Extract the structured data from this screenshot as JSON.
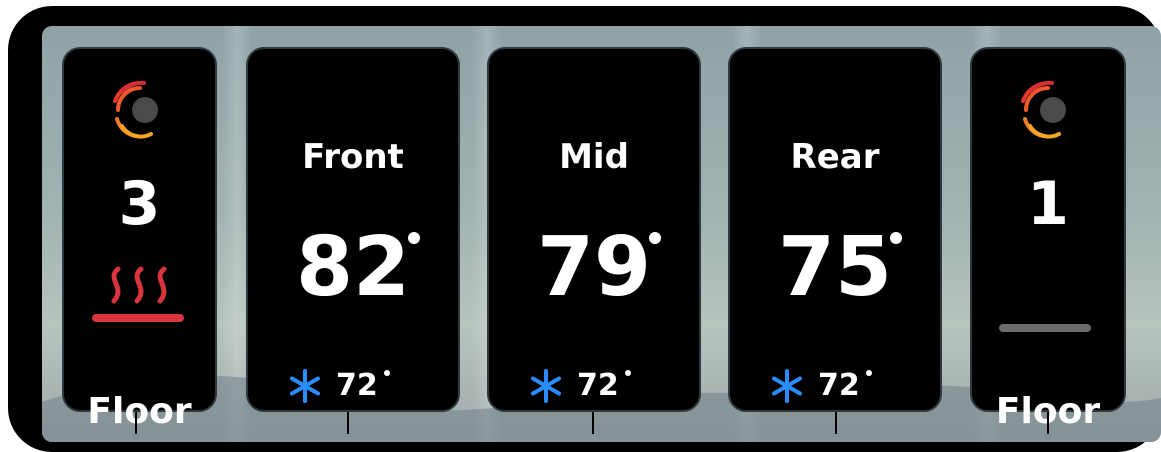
{
  "left_floor": {
    "level": "3",
    "label": "Floor",
    "heat_active": true
  },
  "zones": [
    {
      "name": "Front",
      "temp": "82",
      "setpoint": "72"
    },
    {
      "name": "Mid",
      "temp": "79",
      "setpoint": "72"
    },
    {
      "name": "Rear",
      "temp": "75",
      "setpoint": "72"
    }
  ],
  "right_floor": {
    "level": "1",
    "label": "Floor",
    "heat_active": false
  },
  "icons": {
    "heat_source": "radiant-heat-icon",
    "floor_heat": "floor-heat-icon",
    "cooling": "snowflake-icon"
  },
  "colors": {
    "card_bg": "#000000",
    "heat_red": "#d9343b",
    "snow_blue": "#2a8cff",
    "inactive_bar": "#6a6a6a"
  }
}
